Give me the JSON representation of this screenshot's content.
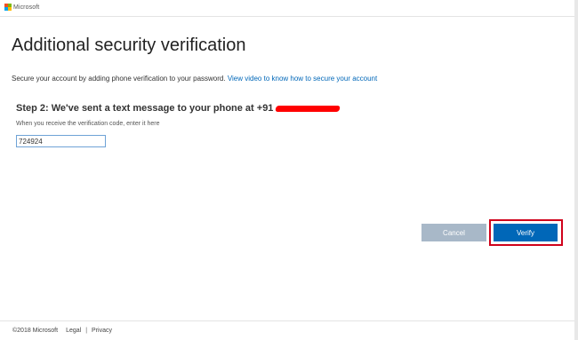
{
  "header": {
    "brand": "Microsoft",
    "logo_colors": [
      "#f25022",
      "#7fba00",
      "#00a4ef",
      "#ffb900"
    ]
  },
  "main": {
    "title": "Additional security verification",
    "description": "Secure your account by adding phone verification to your password.",
    "video_link": "View video to know how to secure your account",
    "step_text": "Step 2: We've sent a text message to your phone at +91",
    "hint": "When you receive the verification code, enter it here",
    "code_value": "724924"
  },
  "actions": {
    "cancel_label": "Cancel",
    "verify_label": "Verify",
    "verify_color": "#0067b8",
    "cancel_color": "#a8b8c8",
    "highlight_color": "#d0021b"
  },
  "footer": {
    "copyright": "©2018 Microsoft",
    "legal": "Legal",
    "separator": "|",
    "privacy": "Privacy"
  }
}
